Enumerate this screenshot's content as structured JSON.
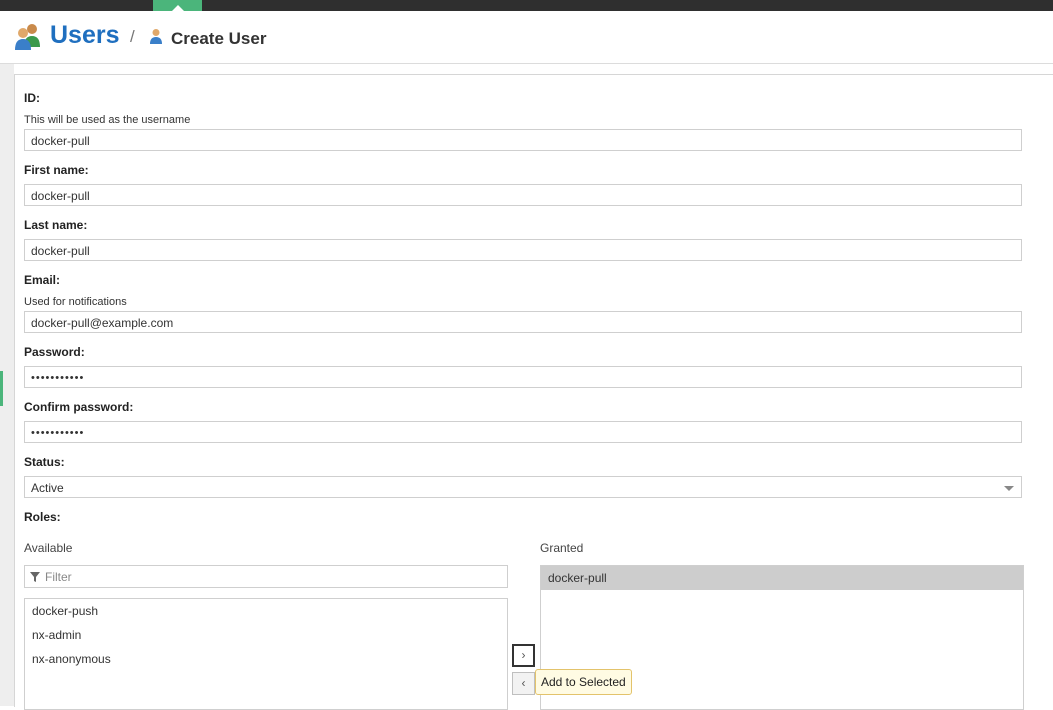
{
  "header": {
    "title": "Users",
    "separator": "/",
    "subtitle": "Create User"
  },
  "form": {
    "id": {
      "label": "ID:",
      "help": "This will be used as the username",
      "value": "docker-pull"
    },
    "first_name": {
      "label": "First name:",
      "value": "docker-pull"
    },
    "last_name": {
      "label": "Last name:",
      "value": "docker-pull"
    },
    "email": {
      "label": "Email:",
      "help": "Used for notifications",
      "value": "docker-pull@example.com"
    },
    "password": {
      "label": "Password:",
      "value": "•••••••••••"
    },
    "confirm_password": {
      "label": "Confirm password:",
      "value": "•••••••••••"
    },
    "status": {
      "label": "Status:",
      "value": "Active"
    },
    "roles": {
      "label": "Roles:",
      "available_label": "Available",
      "granted_label": "Granted",
      "filter_placeholder": "Filter",
      "available": [
        "docker-push",
        "nx-admin",
        "nx-anonymous"
      ],
      "granted": [
        "docker-pull"
      ],
      "add_symbol": "›",
      "remove_symbol": "‹",
      "tooltip": "Add to Selected"
    }
  },
  "colors": {
    "accent": "#4bb57b",
    "title_blue": "#1f6fbf",
    "topbar": "#2f2f2f"
  }
}
